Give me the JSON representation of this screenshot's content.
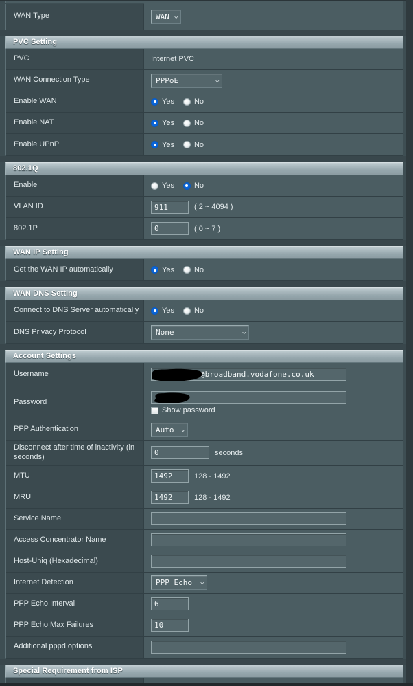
{
  "page": {
    "title": "WAN Settings",
    "colors": {
      "panel_bg": "#3e4e53",
      "row_value_bg": "#4b5d62",
      "row_label_bg": "#3b4a4f",
      "section_header_light": "#c3cfd3",
      "section_header_dark": "#8b9ca2",
      "radio_selected": "#0b65d8",
      "input_bg": "#54666b",
      "input_border": "#93a4a8",
      "redaction": "#000000"
    }
  },
  "top_partial_row": {
    "label": "WAN Type",
    "select": {
      "value": "WAN",
      "caret": "chevron-down-icon"
    }
  },
  "sections": [
    {
      "id": "pvc-setting",
      "title": "PVC Setting",
      "rows": [
        {
          "id": "pvc",
          "label": "PVC",
          "type": "static",
          "value": "Internet PVC"
        },
        {
          "id": "wan-connection-type",
          "label": "WAN Connection Type",
          "type": "select",
          "value": "PPPoE",
          "caret": "chevron-down-icon"
        },
        {
          "id": "enable-wan",
          "label": "Enable WAN",
          "type": "radio",
          "options": [
            "Yes",
            "No"
          ],
          "selected": "Yes"
        },
        {
          "id": "enable-nat",
          "label": "Enable NAT",
          "type": "radio",
          "options": [
            "Yes",
            "No"
          ],
          "selected": "Yes"
        },
        {
          "id": "enable-upnp",
          "label": "Enable UPnP",
          "type": "radio",
          "options": [
            "Yes",
            "No"
          ],
          "selected": "Yes"
        }
      ]
    },
    {
      "id": "dot1q",
      "title": "802.1Q",
      "rows": [
        {
          "id": "enable-8021q",
          "label": "Enable",
          "type": "radio",
          "options": [
            "Yes",
            "No"
          ],
          "selected": "No"
        },
        {
          "id": "vlan-id",
          "label": "VLAN ID",
          "type": "input",
          "value": "911",
          "hint": "( 2 ~ 4094 )"
        },
        {
          "id": "dot1p",
          "label": "802.1P",
          "type": "input",
          "value": "0",
          "hint": "( 0 ~ 7 )"
        }
      ]
    },
    {
      "id": "wan-ip-setting",
      "title": "WAN IP Setting",
      "rows": [
        {
          "id": "get-wan-ip-automatically",
          "label": "Get the WAN IP automatically",
          "type": "radio",
          "options": [
            "Yes",
            "No"
          ],
          "selected": "Yes"
        }
      ]
    },
    {
      "id": "wan-dns-setting",
      "title": "WAN DNS Setting",
      "rows": [
        {
          "id": "connect-dns-automatically",
          "label": "Connect to DNS Server automatically",
          "type": "radio",
          "options": [
            "Yes",
            "No"
          ],
          "selected": "Yes"
        },
        {
          "id": "dns-privacy-protocol",
          "label": "DNS Privacy Protocol",
          "type": "select",
          "value": "None",
          "caret": "chevron-down-icon"
        }
      ]
    },
    {
      "id": "account-settings",
      "title": "Account Settings",
      "rows": [
        {
          "id": "username",
          "label": "Username",
          "type": "input-redacted",
          "value": "@broadband.vodafone.co.uk",
          "redacted": true
        },
        {
          "id": "password",
          "label": "Password",
          "type": "password-redacted",
          "value": "",
          "redacted": true,
          "checkbox_label": "Show password",
          "checkbox_checked": false
        },
        {
          "id": "ppp-authentication",
          "label": "PPP Authentication",
          "type": "select",
          "value": "Auto",
          "caret": "chevron-down-icon"
        },
        {
          "id": "disconnect-inactivity",
          "label": "Disconnect after time of inactivity (in seconds)",
          "type": "input",
          "value": "0",
          "hint": "seconds"
        },
        {
          "id": "mtu",
          "label": "MTU",
          "type": "input",
          "value": "1492",
          "hint": "128 - 1492"
        },
        {
          "id": "mru",
          "label": "MRU",
          "type": "input",
          "value": "1492",
          "hint": "128 - 1492"
        },
        {
          "id": "service-name",
          "label": "Service Name",
          "type": "input-wide",
          "value": "",
          "hint": ""
        },
        {
          "id": "access-concentrator-name",
          "label": "Access Concentrator Name",
          "type": "input-wide",
          "value": "",
          "hint": ""
        },
        {
          "id": "host-uniq",
          "label": "Host-Uniq (Hexadecimal)",
          "type": "input-wide",
          "value": "",
          "hint": ""
        },
        {
          "id": "internet-detection",
          "label": "Internet Detection",
          "type": "select",
          "value": "PPP Echo",
          "caret": "chevron-down-icon"
        },
        {
          "id": "ppp-echo-interval",
          "label": "PPP Echo Interval",
          "type": "input",
          "value": "6",
          "hint": ""
        },
        {
          "id": "ppp-echo-max-failures",
          "label": "PPP Echo Max Failures",
          "type": "input",
          "value": "10",
          "hint": ""
        },
        {
          "id": "additional-pppd-options",
          "label": "Additional pppd options",
          "type": "input-wide",
          "value": "",
          "hint": ""
        }
      ]
    },
    {
      "id": "special-requirement-isp",
      "title": "Special Requirement from ISP",
      "rows": []
    }
  ]
}
